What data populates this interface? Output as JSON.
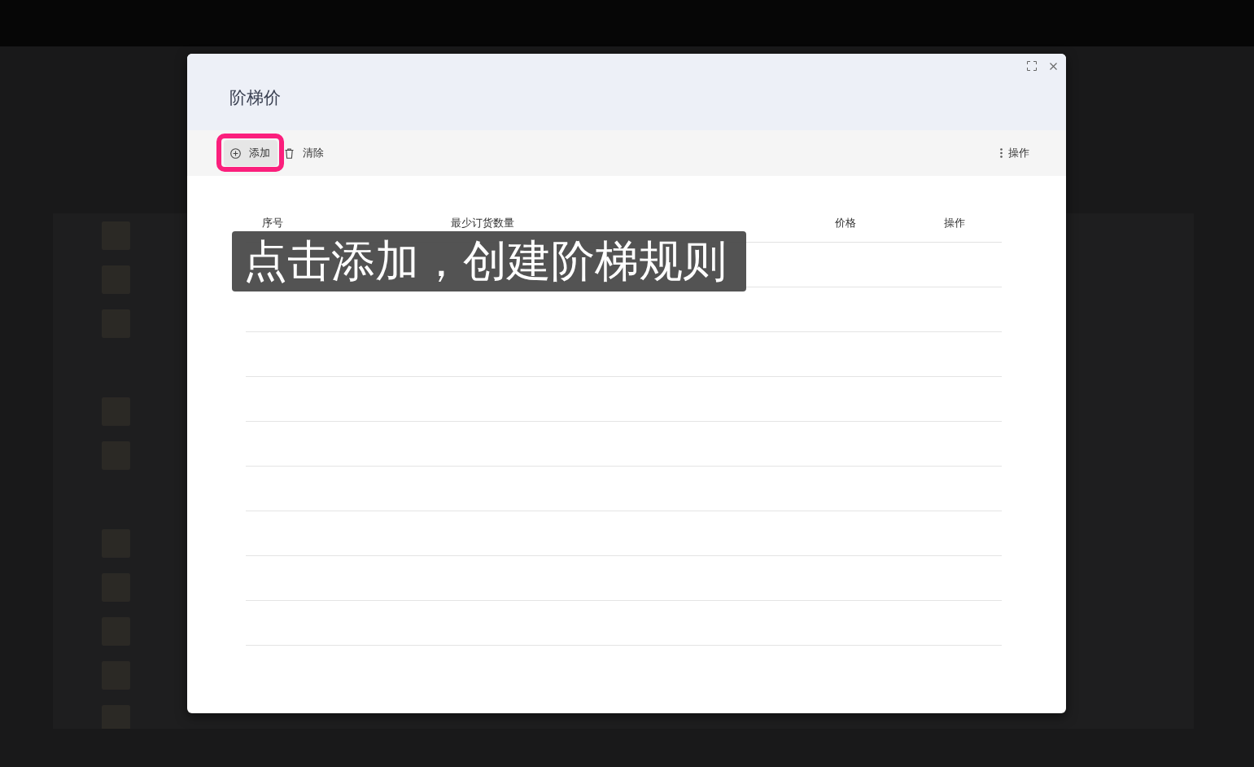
{
  "background_table": {
    "rows": [
      {
        "has_photo": true
      },
      {
        "has_photo": true
      },
      {
        "has_photo": true
      },
      {
        "has_photo": false
      },
      {
        "has_photo": true
      },
      {
        "has_photo": true
      },
      {
        "has_photo": false
      },
      {
        "has_photo": true
      },
      {
        "has_photo": true
      },
      {
        "has_photo": true
      },
      {
        "has_photo": true
      },
      {
        "has_photo": true
      }
    ]
  },
  "dialog": {
    "title": "阶梯价",
    "toolbar": {
      "buttons": [
        {
          "kind": "add",
          "label": "添加",
          "highlighted": true
        },
        {
          "kind": "clear",
          "label": "清除",
          "highlighted": false
        }
      ],
      "menu": {
        "label": "操作"
      }
    },
    "table": {
      "columns": [
        "序号",
        "最少订货数量",
        "价格",
        "操作"
      ]
    }
  },
  "caption": {
    "text": "点击添加，创建阶梯规则"
  }
}
